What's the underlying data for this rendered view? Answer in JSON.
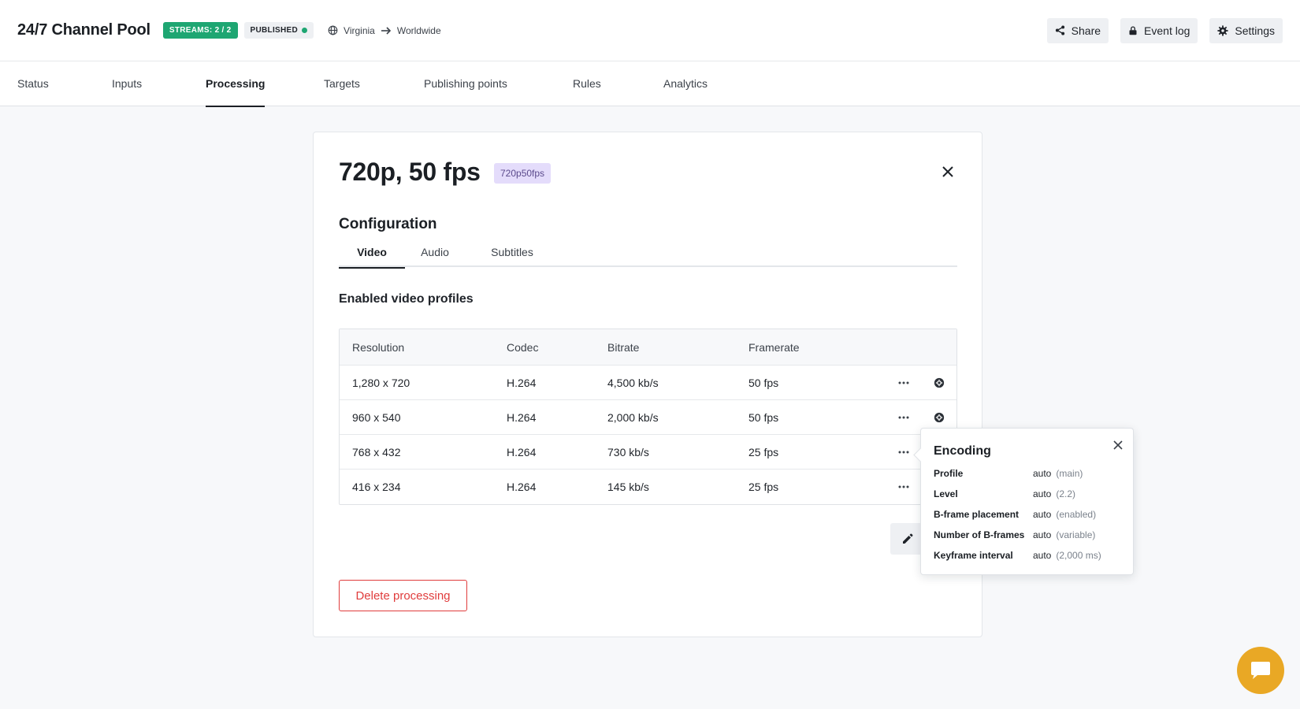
{
  "header": {
    "title": "24/7 Channel Pool",
    "streams_badge": "STREAMS: 2 / 2",
    "published_badge": "PUBLISHED",
    "region_from": "Virginia",
    "region_to": "Worldwide",
    "actions": {
      "share": "Share",
      "event_log": "Event log",
      "settings": "Settings"
    }
  },
  "nav": {
    "tabs": [
      "Status",
      "Inputs",
      "Processing",
      "Targets",
      "Publishing points",
      "Rules",
      "Analytics"
    ],
    "active": "Processing"
  },
  "card": {
    "title": "720p, 50 fps",
    "tag": "720p50fps",
    "section_title": "Configuration",
    "sub_tabs": [
      "Video",
      "Audio",
      "Subtitles"
    ],
    "active_sub_tab": "Video",
    "profiles_title": "Enabled video profiles",
    "table": {
      "headers": [
        "Resolution",
        "Codec",
        "Bitrate",
        "Framerate"
      ],
      "rows": [
        {
          "resolution": "1,280 x 720",
          "codec": "H.264",
          "bitrate": "4,500 kb/s",
          "framerate": "50 fps"
        },
        {
          "resolution": "960 x 540",
          "codec": "H.264",
          "bitrate": "2,000 kb/s",
          "framerate": "50 fps"
        },
        {
          "resolution": "768 x 432",
          "codec": "H.264",
          "bitrate": "730 kb/s",
          "framerate": "25 fps"
        },
        {
          "resolution": "416 x 234",
          "codec": "H.264",
          "bitrate": "145 kb/s",
          "framerate": "25 fps"
        }
      ]
    },
    "delete_label": "Delete processing"
  },
  "popover": {
    "title": "Encoding",
    "rows": [
      {
        "label": "Profile",
        "value": "auto",
        "hint": "(main)"
      },
      {
        "label": "Level",
        "value": "auto",
        "hint": "(2.2)"
      },
      {
        "label": "B-frame placement",
        "value": "auto",
        "hint": "(enabled)"
      },
      {
        "label": "Number of B-frames",
        "value": "auto",
        "hint": "(variable)"
      },
      {
        "label": "Keyframe interval",
        "value": "auto",
        "hint": "(2,000 ms)"
      }
    ]
  },
  "colors": {
    "accent_green": "#1ea672",
    "danger_red": "#e03c3c",
    "tag_purple": "#e4dcfb",
    "chat_yellow": "#e9a825"
  },
  "icons": {
    "region": "globe-icon",
    "region_arrow": "arrow-right-icon",
    "share": "share-icon",
    "event_log": "log-icon",
    "settings": "gear-icon",
    "close": "close-icon",
    "row_menu": "more-horizontal-icon",
    "row_settings": "gear-icon",
    "edit": "pencil-icon",
    "chat": "chat-icon"
  }
}
